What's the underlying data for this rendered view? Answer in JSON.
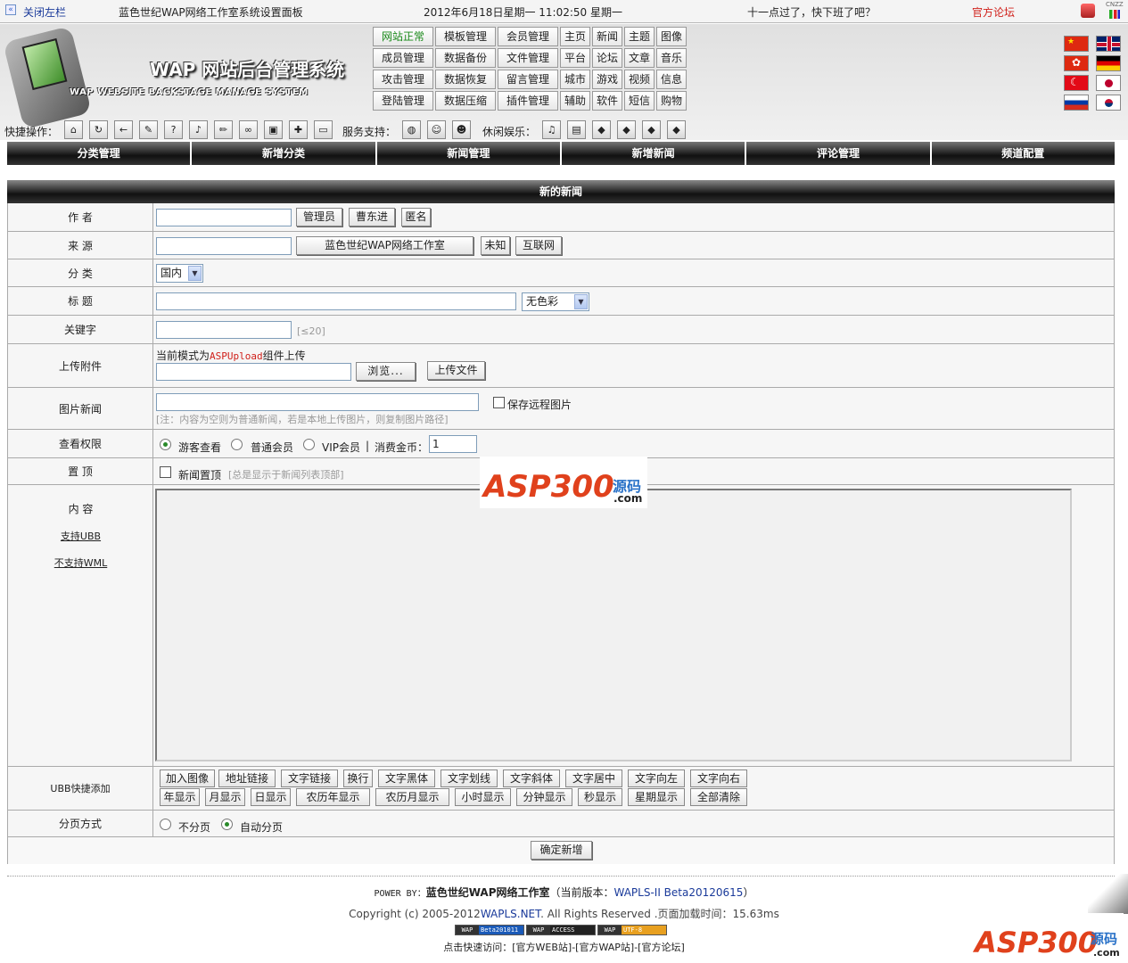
{
  "topbar": {
    "close_left": "关闭左栏",
    "site_title": "蓝色世纪WAP网络工作室系统设置面板",
    "datetime": "2012年6月18日星期一 11:02:50 星期一",
    "greeting": "十一点过了，快下班了吧？",
    "forum": "官方论坛",
    "cnzz": "CNZZ"
  },
  "logo": {
    "title": "WAP 网站后台管理系统",
    "subtitle": "WAP WEBSITE BACKSTAGE MANAGE SYSTEM"
  },
  "menu": [
    "网站正常",
    "模板管理",
    "会员管理",
    "主页",
    "新闻",
    "主题",
    "图像",
    "成员管理",
    "数据备份",
    "文件管理",
    "平台",
    "论坛",
    "文章",
    "音乐",
    "攻击管理",
    "数据恢复",
    "留言管理",
    "城市",
    "游戏",
    "视频",
    "信息",
    "登陆管理",
    "数据压缩",
    "插件管理",
    "辅助",
    "软件",
    "短信",
    "购物"
  ],
  "quick": {
    "ops": "快捷操作：",
    "service": "服务支持：",
    "leisure": "休闲娱乐："
  },
  "icons": [
    "home-icon",
    "refresh-icon",
    "back-icon",
    "pen-icon",
    "help-icon",
    "sound-icon",
    "pencil-icon",
    "link-icon",
    "box-icon",
    "puzzle-icon",
    "window-icon",
    "globe-icon",
    "user-icon",
    "user2-icon",
    "music-icon",
    "doc-icon",
    "game1-icon",
    "game2-icon",
    "game3-icon",
    "game4-icon"
  ],
  "flags": [
    "cn",
    "gb",
    "hk",
    "de",
    "tr",
    "jp",
    "ru",
    "kr"
  ],
  "tabs": [
    "分类管理",
    "新增分类",
    "新闻管理",
    "新增新闻",
    "评论管理",
    "频道配置"
  ],
  "panel": {
    "title": "新的新闻"
  },
  "form": {
    "author": {
      "label": "作 者",
      "btn1": "管理员",
      "btn2": "曹东进",
      "btn3": "匿名"
    },
    "source": {
      "label": "来 源",
      "btn1": "蓝色世纪WAP网络工作室",
      "btn2": "未知",
      "btn3": "互联网"
    },
    "category": {
      "label": "分 类",
      "value": "国内"
    },
    "title": {
      "label": "标 题",
      "color": "无色彩"
    },
    "keywords": {
      "label": "关键字",
      "hint": "[≤20]"
    },
    "upload": {
      "label": "上传附件",
      "mode_prefix": "当前模式为",
      "mode_name": "ASPUpload",
      "mode_suffix": "组件上传",
      "browse": "浏览...",
      "upload_btn": "上传文件"
    },
    "image": {
      "label": "图片新闻",
      "save_remote": "保存远程图片",
      "hint": "[注：内容为空则为普通新闻，若是本地上传图片，则复制图片路径]"
    },
    "perm": {
      "label": "查看权限",
      "opt1": "游客查看",
      "opt2": "普通会员",
      "opt3": "VIP会员",
      "sep": "|",
      "coin_label": "消费金币：",
      "coin_value": "1"
    },
    "top": {
      "label": "置 顶",
      "chk": "新闻置顶",
      "hint": "[总是显示于新闻列表顶部]"
    },
    "content": {
      "label": "内 容",
      "ubb": "支持UBB",
      "wml": "不支持WML"
    },
    "ubb": {
      "label": "UBB快捷添加",
      "row1": [
        "加入图像",
        "地址链接",
        "文字链接",
        "换行",
        "文字黑体",
        "文字划线",
        "文字斜体",
        "文字居中",
        "文字向左",
        "文字向右"
      ],
      "row2": [
        "年显示",
        "月显示",
        "日显示",
        "农历年显示",
        "农历月显示",
        "小时显示",
        "分钟显示",
        "秒显示",
        "星期显示",
        "全部清除"
      ]
    },
    "paging": {
      "label": "分页方式",
      "opt1": "不分页",
      "opt2": "自动分页"
    },
    "submit": "确定新增"
  },
  "footer": {
    "power_prefix": "POWER BY：",
    "power_name": "蓝色世纪WAP网络工作室",
    "version_prefix": "（当前版本：",
    "version": "WAPLS-II Beta20120615",
    "version_suffix": "）",
    "copyright_prefix": "Copyright (c) 2005-2012",
    "copyright_site": "WAPLS.NET",
    "copyright_suffix": ". All Rights Reserved .页面加载时间：15.63ms",
    "badges": [
      {
        "left": "WAP",
        "right": "Beta201011"
      },
      {
        "left": "WAP",
        "right": "ACCESS"
      },
      {
        "left": "WAP",
        "right": "UTF-8"
      }
    ],
    "quick_visit": "点击快速访问：[官方WEB站]-[官方WAP站]-[官方论坛]"
  },
  "watermark": {
    "text": "ASP300",
    "cn": "源码",
    "com": ".com"
  },
  "colors": {
    "accent_green": "#1a8a1a",
    "header_dark": "#111111",
    "upload_red": "#d0201a",
    "link_blue": "#1a3a9a"
  }
}
